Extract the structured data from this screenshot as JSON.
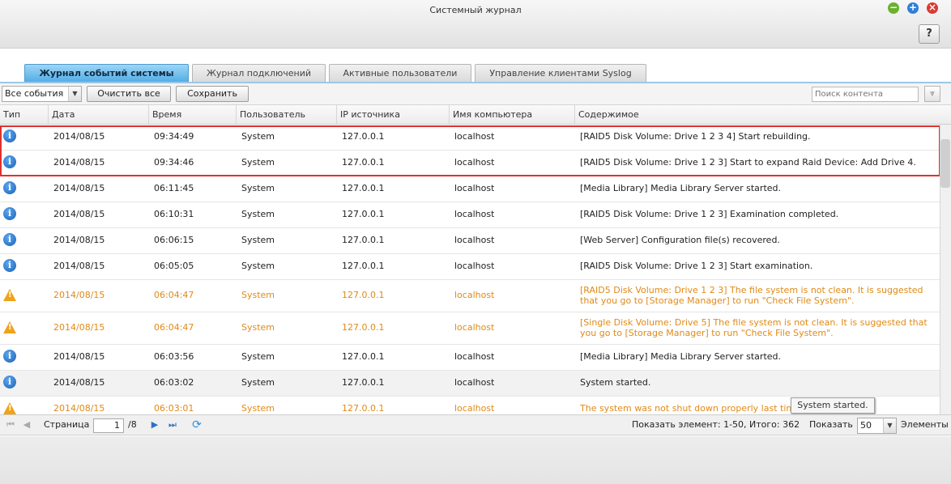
{
  "window": {
    "title": "Системный журнал",
    "help": "?"
  },
  "tabs": [
    {
      "label": "Журнал событий системы",
      "active": true
    },
    {
      "label": "Журнал подключений",
      "active": false
    },
    {
      "label": "Активные пользователи",
      "active": false
    },
    {
      "label": "Управление клиентами Syslog",
      "active": false
    }
  ],
  "toolbar": {
    "filter_value": "Все события",
    "clear_label": "Очистить все",
    "save_label": "Сохранить",
    "search_placeholder": "Поиск контента"
  },
  "columns": [
    "Тип",
    "Дата",
    "Время",
    "Пользователь",
    "IP источника",
    "Имя компьютера",
    "Содержимое"
  ],
  "rows": [
    {
      "type": "info",
      "date": "2014/08/15",
      "time": "09:34:49",
      "user": "System",
      "ip": "127.0.0.1",
      "host": "localhost",
      "content": "[RAID5 Disk Volume: Drive 1 2 3 4] Start rebuilding."
    },
    {
      "type": "info",
      "date": "2014/08/15",
      "time": "09:34:46",
      "user": "System",
      "ip": "127.0.0.1",
      "host": "localhost",
      "content": "[RAID5 Disk Volume: Drive 1 2 3] Start to expand Raid Device: Add Drive 4."
    },
    {
      "type": "info",
      "date": "2014/08/15",
      "time": "06:11:45",
      "user": "System",
      "ip": "127.0.0.1",
      "host": "localhost",
      "content": "[Media Library] Media Library Server started."
    },
    {
      "type": "info",
      "date": "2014/08/15",
      "time": "06:10:31",
      "user": "System",
      "ip": "127.0.0.1",
      "host": "localhost",
      "content": "[RAID5 Disk Volume: Drive 1 2 3] Examination completed."
    },
    {
      "type": "info",
      "date": "2014/08/15",
      "time": "06:06:15",
      "user": "System",
      "ip": "127.0.0.1",
      "host": "localhost",
      "content": "[Web Server] Configuration file(s) recovered."
    },
    {
      "type": "info",
      "date": "2014/08/15",
      "time": "06:05:05",
      "user": "System",
      "ip": "127.0.0.1",
      "host": "localhost",
      "content": "[RAID5 Disk Volume: Drive 1 2 3] Start examination."
    },
    {
      "type": "warning",
      "date": "2014/08/15",
      "time": "06:04:47",
      "user": "System",
      "ip": "127.0.0.1",
      "host": "localhost",
      "content": "[RAID5 Disk Volume: Drive 1 2 3] The file system is not clean. It is suggested that you go to [Storage Manager] to run \"Check File System\"."
    },
    {
      "type": "warning",
      "date": "2014/08/15",
      "time": "06:04:47",
      "user": "System",
      "ip": "127.0.0.1",
      "host": "localhost",
      "content": "[Single Disk Volume: Drive 5] The file system is not clean. It is suggested that you go to [Storage Manager] to run \"Check File System\"."
    },
    {
      "type": "info",
      "date": "2014/08/15",
      "time": "06:03:56",
      "user": "System",
      "ip": "127.0.0.1",
      "host": "localhost",
      "content": "[Media Library] Media Library Server started."
    },
    {
      "type": "info",
      "date": "2014/08/15",
      "time": "06:03:02",
      "user": "System",
      "ip": "127.0.0.1",
      "host": "localhost",
      "content": "System started."
    },
    {
      "type": "warning",
      "date": "2014/08/15",
      "time": "06:03:01",
      "user": "System",
      "ip": "127.0.0.1",
      "host": "localhost",
      "content": "The system was not shut down properly last time."
    }
  ],
  "tooltip": "System started.",
  "pager": {
    "page_label": "Страница",
    "page_value": "1",
    "page_total": "/8",
    "summary": "Показать элемент: 1-50, Итого: 362",
    "show_label": "Показать",
    "per_page": "50",
    "items_label": "Элементы"
  }
}
